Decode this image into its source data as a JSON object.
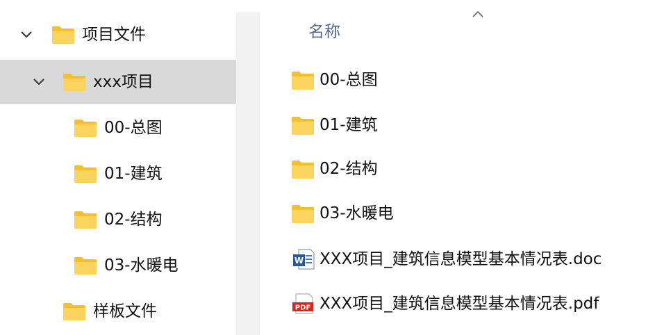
{
  "nav": {
    "items": [
      {
        "label": "项目文件",
        "expanded": true,
        "selected": false,
        "icon": "folder-icon"
      },
      {
        "label": "xxx项目",
        "expanded": true,
        "selected": true,
        "icon": "folder-icon"
      },
      {
        "label": "00-总图",
        "icon": "folder-icon"
      },
      {
        "label": "01-建筑",
        "icon": "folder-icon"
      },
      {
        "label": "02-结构",
        "icon": "folder-icon"
      },
      {
        "label": "03-水暖电",
        "icon": "folder-icon"
      },
      {
        "label": "样板文件",
        "icon": "folder-icon"
      }
    ]
  },
  "content": {
    "column_header": "名称",
    "sort": "ascending",
    "files": [
      {
        "name": "00-总图",
        "type": "folder",
        "icon": "folder-icon"
      },
      {
        "name": "01-建筑",
        "type": "folder",
        "icon": "folder-icon"
      },
      {
        "name": "02-结构",
        "type": "folder",
        "icon": "folder-icon"
      },
      {
        "name": "03-水暖电",
        "type": "folder",
        "icon": "folder-icon"
      },
      {
        "name": "XXX项目_建筑信息模型基本情况表.doc",
        "type": "doc",
        "icon": "word-doc-icon"
      },
      {
        "name": "XXX项目_建筑信息模型基本情况表.pdf",
        "type": "pdf",
        "icon": "pdf-icon"
      }
    ]
  },
  "colors": {
    "selected_bg": "#d9d9d9",
    "folder_yellow": "#f8c73a",
    "folder_yellow_light": "#fbd977",
    "header_text": "#5a6a85",
    "word_blue": "#2b5797",
    "pdf_red": "#d9261c"
  }
}
